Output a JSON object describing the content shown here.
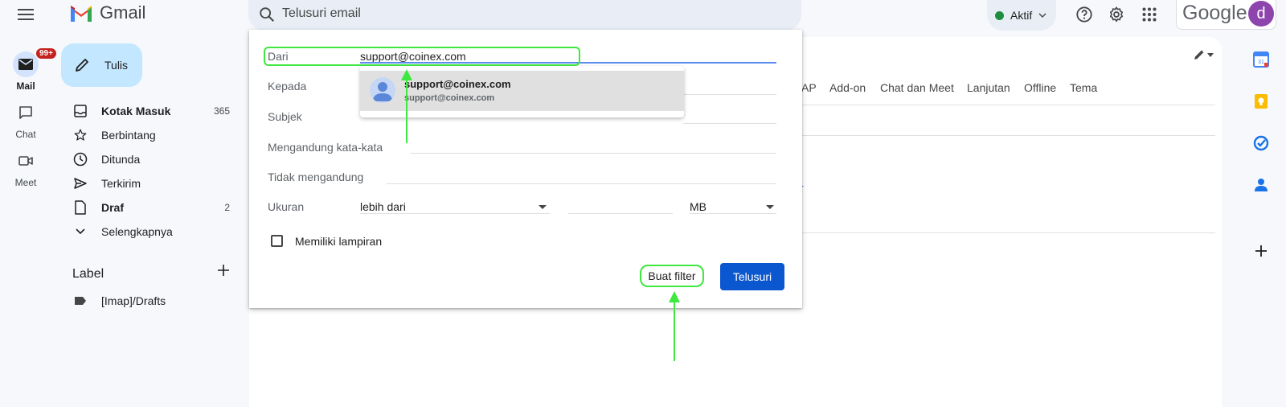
{
  "app": {
    "name": "Gmail"
  },
  "search": {
    "placeholder": "Telusuri email"
  },
  "status": {
    "label": "Aktif"
  },
  "account": {
    "brand": "Google",
    "avatar_letter": "d"
  },
  "rail": {
    "mail": {
      "label": "Mail",
      "badge": "99+"
    },
    "chat": {
      "label": "Chat"
    },
    "meet": {
      "label": "Meet"
    }
  },
  "compose": {
    "label": "Tulis"
  },
  "nav": [
    {
      "label": "Kotak Masuk",
      "count": "365"
    },
    {
      "label": "Berbintang",
      "count": ""
    },
    {
      "label": "Ditunda",
      "count": ""
    },
    {
      "label": "Terkirim",
      "count": ""
    },
    {
      "label": "Draf",
      "count": "2"
    },
    {
      "label": "Selengkapnya",
      "count": ""
    }
  ],
  "labels": {
    "heading": "Label",
    "items": [
      {
        "label": "[Imap]/Drafts"
      }
    ]
  },
  "settings_tabs": [
    "AP",
    "Add-on",
    "Chat dan Meet",
    "Lanjutan",
    "Offline",
    "Tema"
  ],
  "partial_link": "er",
  "dialog": {
    "from_label": "Dari",
    "from_value": "support@coinex.com",
    "to_label": "Kepada",
    "subject_label": "Subjek",
    "has_words_label": "Mengandung kata-kata",
    "no_words_label": "Tidak mengandung",
    "size_label": "Ukuran",
    "size_operator": "lebih dari",
    "size_unit": "MB",
    "attachment_label": "Memiliki lampiran",
    "create_filter": "Buat filter",
    "search_button": "Telusuri"
  },
  "autocomplete": {
    "name": "support@coinex.com",
    "email": "support@coinex.com"
  },
  "colors": {
    "accent": "#0b57d0",
    "highlight": "#3ee83e",
    "compose_bg": "#c2e7ff",
    "status_green": "#1e8e3e"
  }
}
